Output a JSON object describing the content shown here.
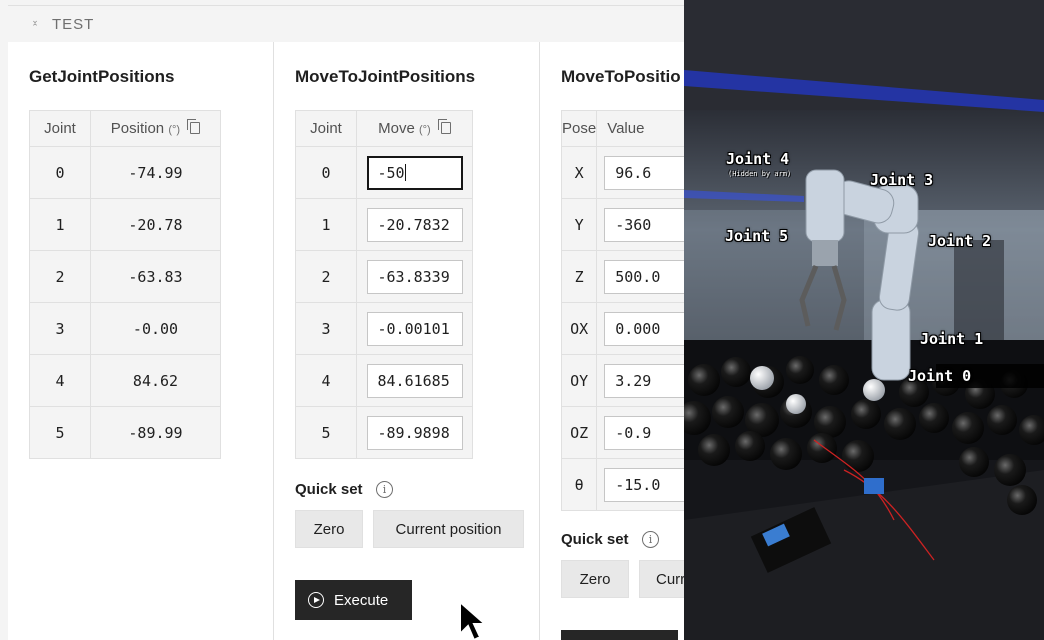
{
  "section": {
    "title": "TEST"
  },
  "get_joint_positions": {
    "title": "GetJointPositions",
    "columns": {
      "joint": "Joint",
      "position": "Position",
      "unit": "(°)"
    },
    "rows": [
      {
        "joint": "0",
        "position": "-74.99"
      },
      {
        "joint": "1",
        "position": "-20.78"
      },
      {
        "joint": "2",
        "position": "-63.83"
      },
      {
        "joint": "3",
        "position": "-0.00"
      },
      {
        "joint": "4",
        "position": "84.62"
      },
      {
        "joint": "5",
        "position": "-89.99"
      }
    ]
  },
  "move_to_joint_positions": {
    "title": "MoveToJointPositions",
    "columns": {
      "joint": "Joint",
      "move": "Move",
      "unit": "(°)"
    },
    "rows": [
      {
        "joint": "0",
        "value": "-50"
      },
      {
        "joint": "1",
        "value": "-20.7832"
      },
      {
        "joint": "2",
        "value": "-63.8339"
      },
      {
        "joint": "3",
        "value": "-0.00101"
      },
      {
        "joint": "4",
        "value": "84.61685"
      },
      {
        "joint": "5",
        "value": "-89.9898"
      }
    ],
    "quick_set_label": "Quick set",
    "zero_label": "Zero",
    "current_position_label": "Current position",
    "execute_label": "Execute"
  },
  "move_to_position": {
    "title": "MoveToPositio",
    "columns": {
      "pose": "Pose",
      "value": "Value"
    },
    "rows": [
      {
        "pose": "X",
        "value": "96.6"
      },
      {
        "pose": "Y",
        "value": "-360"
      },
      {
        "pose": "Z",
        "value": "500.0"
      },
      {
        "pose": "OX",
        "value": "0.000"
      },
      {
        "pose": "OY",
        "value": "3.29"
      },
      {
        "pose": "OZ",
        "value": "-0.9"
      },
      {
        "pose": "θ",
        "value": "-15.0"
      }
    ],
    "quick_set_label": "Quick set",
    "zero_label": "Zero",
    "current_label": "Curr"
  },
  "video_overlay": {
    "joint4": "Joint 4",
    "joint4_note": "(Hidden by arm)",
    "joint3": "Joint 3",
    "joint5": "Joint 5",
    "joint2": "Joint 2",
    "joint1": "Joint 1",
    "joint0": "Joint 0"
  },
  "colors": {
    "primary_button": "#262626",
    "panel_bg": "#f4f4f4",
    "border": "#e0e0e0"
  }
}
